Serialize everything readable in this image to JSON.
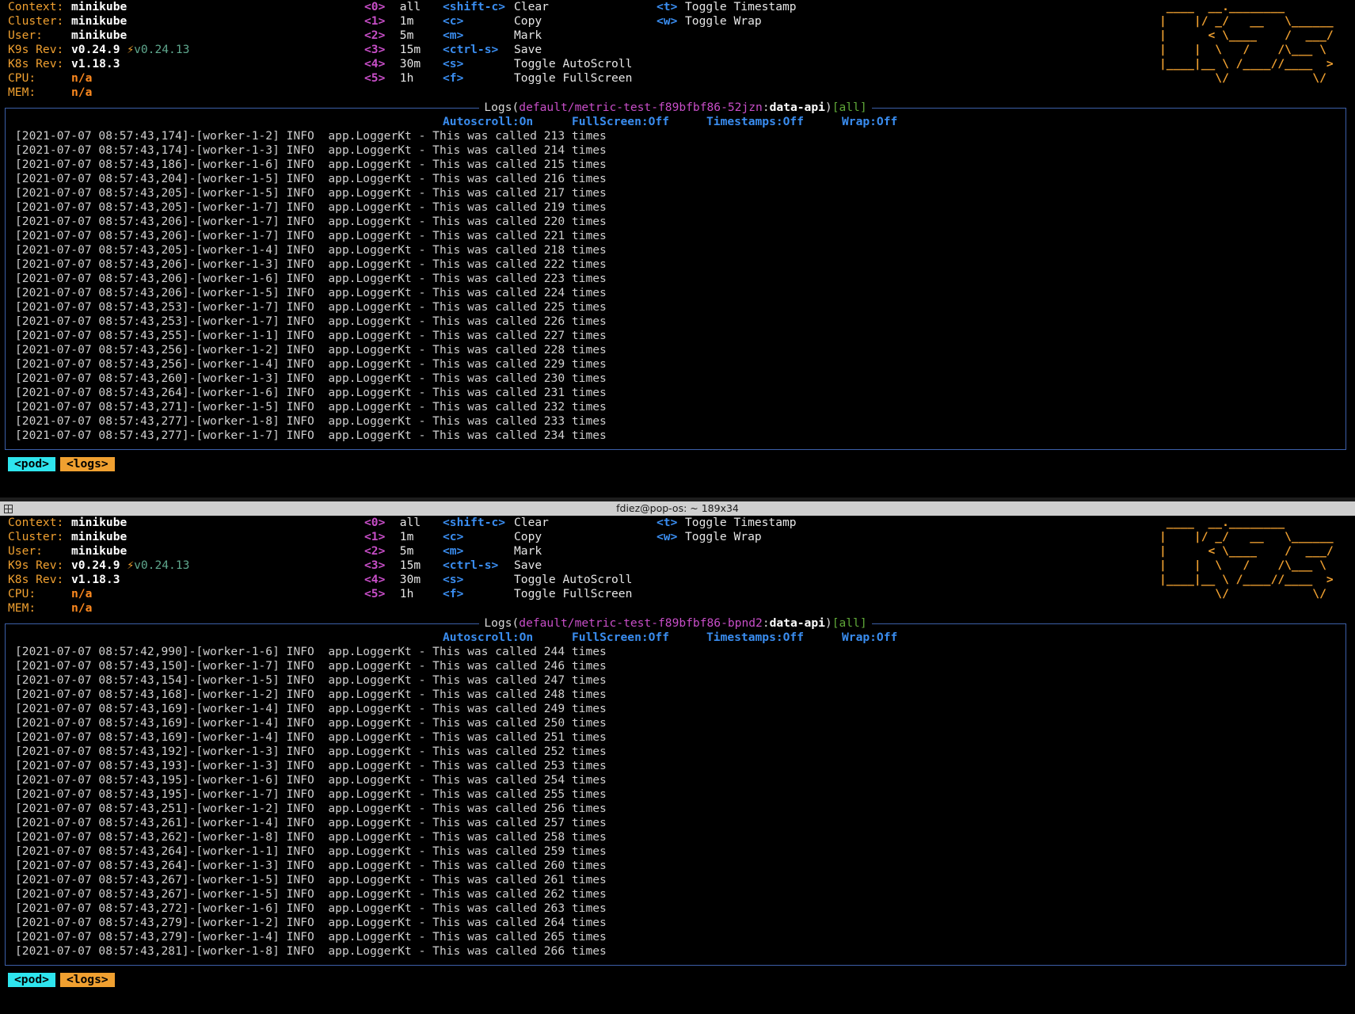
{
  "title_bar": {
    "text": "fdiez@pop-os: ~ 189x34"
  },
  "panes": [
    {
      "info": {
        "context_label": "Context:",
        "context": "minikube",
        "cluster_label": "Cluster:",
        "cluster": "minikube",
        "user_label": "User:",
        "user": "minikube",
        "k9s_label": "K9s Rev:",
        "k9s_rev": "v0.24.9",
        "k9s_new": "v0.24.13",
        "k8s_label": "K8s Rev:",
        "k8s_rev": "v1.18.3",
        "cpu_label": "CPU:",
        "cpu": "n/a",
        "mem_label": "MEM:",
        "mem": "n/a"
      },
      "ranges": [
        {
          "key": "<0>",
          "label": "all"
        },
        {
          "key": "<1>",
          "label": "1m"
        },
        {
          "key": "<2>",
          "label": "5m"
        },
        {
          "key": "<3>",
          "label": "15m"
        },
        {
          "key": "<4>",
          "label": "30m"
        },
        {
          "key": "<5>",
          "label": "1h"
        }
      ],
      "hotkeys": [
        {
          "key": "<shift-c>",
          "label": "Clear"
        },
        {
          "key": "<c>",
          "label": "Copy"
        },
        {
          "key": "<m>",
          "label": "Mark"
        },
        {
          "key": "<ctrl-s>",
          "label": "Save"
        },
        {
          "key": "<s>",
          "label": "Toggle AutoScroll"
        },
        {
          "key": "<f>",
          "label": "Toggle FullScreen"
        }
      ],
      "toggles": [
        {
          "key": "<t>",
          "label": "Toggle Timestamp"
        },
        {
          "key": "<w>",
          "label": "Toggle Wrap"
        }
      ],
      "logo": [
        " ____  __.________       ",
        "|    |/ _/   __   \\______",
        "|      < \\____    /  ___/",
        "|    |  \\   /    /\\___ \\ ",
        "|____|__ \\ /____//____  >",
        "        \\/            \\/ "
      ],
      "log_title": {
        "prefix": "Logs(",
        "path": "default/metric-test-f89bfbf86-52jzn",
        "sep": ":",
        "container": "data-api",
        "suffix": ")",
        "filter": "[all]"
      },
      "status": {
        "autoscroll": "Autoscroll:On",
        "fullscreen": "FullScreen:Off",
        "timestamps": "Timestamps:Off",
        "wrap": "Wrap:Off"
      },
      "logs": [
        "[2021-07-07 08:57:43,174]-[worker-1-2] INFO  app.LoggerKt - This was called 213 times",
        "[2021-07-07 08:57:43,174]-[worker-1-3] INFO  app.LoggerKt - This was called 214 times",
        "[2021-07-07 08:57:43,186]-[worker-1-6] INFO  app.LoggerKt - This was called 215 times",
        "[2021-07-07 08:57:43,204]-[worker-1-5] INFO  app.LoggerKt - This was called 216 times",
        "[2021-07-07 08:57:43,205]-[worker-1-5] INFO  app.LoggerKt - This was called 217 times",
        "[2021-07-07 08:57:43,205]-[worker-1-7] INFO  app.LoggerKt - This was called 219 times",
        "[2021-07-07 08:57:43,206]-[worker-1-7] INFO  app.LoggerKt - This was called 220 times",
        "[2021-07-07 08:57:43,206]-[worker-1-7] INFO  app.LoggerKt - This was called 221 times",
        "[2021-07-07 08:57:43,205]-[worker-1-4] INFO  app.LoggerKt - This was called 218 times",
        "[2021-07-07 08:57:43,206]-[worker-1-3] INFO  app.LoggerKt - This was called 222 times",
        "[2021-07-07 08:57:43,206]-[worker-1-6] INFO  app.LoggerKt - This was called 223 times",
        "[2021-07-07 08:57:43,206]-[worker-1-5] INFO  app.LoggerKt - This was called 224 times",
        "[2021-07-07 08:57:43,253]-[worker-1-7] INFO  app.LoggerKt - This was called 225 times",
        "[2021-07-07 08:57:43,253]-[worker-1-7] INFO  app.LoggerKt - This was called 226 times",
        "[2021-07-07 08:57:43,255]-[worker-1-1] INFO  app.LoggerKt - This was called 227 times",
        "[2021-07-07 08:57:43,256]-[worker-1-2] INFO  app.LoggerKt - This was called 228 times",
        "[2021-07-07 08:57:43,256]-[worker-1-4] INFO  app.LoggerKt - This was called 229 times",
        "[2021-07-07 08:57:43,260]-[worker-1-3] INFO  app.LoggerKt - This was called 230 times",
        "[2021-07-07 08:57:43,264]-[worker-1-6] INFO  app.LoggerKt - This was called 231 times",
        "[2021-07-07 08:57:43,271]-[worker-1-5] INFO  app.LoggerKt - This was called 232 times",
        "[2021-07-07 08:57:43,277]-[worker-1-8] INFO  app.LoggerKt - This was called 233 times",
        "[2021-07-07 08:57:43,277]-[worker-1-7] INFO  app.LoggerKt - This was called 234 times"
      ],
      "crumbs": {
        "pod": "<pod>",
        "logs": "<logs>"
      }
    },
    {
      "info": {
        "context_label": "Context:",
        "context": "minikube",
        "cluster_label": "Cluster:",
        "cluster": "minikube",
        "user_label": "User:",
        "user": "minikube",
        "k9s_label": "K9s Rev:",
        "k9s_rev": "v0.24.9",
        "k9s_new": "v0.24.13",
        "k8s_label": "K8s Rev:",
        "k8s_rev": "v1.18.3",
        "cpu_label": "CPU:",
        "cpu": "n/a",
        "mem_label": "MEM:",
        "mem": "n/a"
      },
      "ranges": [
        {
          "key": "<0>",
          "label": "all"
        },
        {
          "key": "<1>",
          "label": "1m"
        },
        {
          "key": "<2>",
          "label": "5m"
        },
        {
          "key": "<3>",
          "label": "15m"
        },
        {
          "key": "<4>",
          "label": "30m"
        },
        {
          "key": "<5>",
          "label": "1h"
        }
      ],
      "hotkeys": [
        {
          "key": "<shift-c>",
          "label": "Clear"
        },
        {
          "key": "<c>",
          "label": "Copy"
        },
        {
          "key": "<m>",
          "label": "Mark"
        },
        {
          "key": "<ctrl-s>",
          "label": "Save"
        },
        {
          "key": "<s>",
          "label": "Toggle AutoScroll"
        },
        {
          "key": "<f>",
          "label": "Toggle FullScreen"
        }
      ],
      "toggles": [
        {
          "key": "<t>",
          "label": "Toggle Timestamp"
        },
        {
          "key": "<w>",
          "label": "Toggle Wrap"
        }
      ],
      "logo": [
        " ____  __.________       ",
        "|    |/ _/   __   \\______",
        "|      < \\____    /  ___/",
        "|    |  \\   /    /\\___ \\ ",
        "|____|__ \\ /____//____  >",
        "        \\/            \\/ "
      ],
      "log_title": {
        "prefix": "Logs(",
        "path": "default/metric-test-f89bfbf86-bpnd2",
        "sep": ":",
        "container": "data-api",
        "suffix": ")",
        "filter": "[all]"
      },
      "status": {
        "autoscroll": "Autoscroll:On",
        "fullscreen": "FullScreen:Off",
        "timestamps": "Timestamps:Off",
        "wrap": "Wrap:Off"
      },
      "logs": [
        "[2021-07-07 08:57:42,990]-[worker-1-6] INFO  app.LoggerKt - This was called 244 times",
        "[2021-07-07 08:57:43,150]-[worker-1-7] INFO  app.LoggerKt - This was called 246 times",
        "[2021-07-07 08:57:43,154]-[worker-1-5] INFO  app.LoggerKt - This was called 247 times",
        "[2021-07-07 08:57:43,168]-[worker-1-2] INFO  app.LoggerKt - This was called 248 times",
        "[2021-07-07 08:57:43,169]-[worker-1-4] INFO  app.LoggerKt - This was called 249 times",
        "[2021-07-07 08:57:43,169]-[worker-1-4] INFO  app.LoggerKt - This was called 250 times",
        "[2021-07-07 08:57:43,169]-[worker-1-4] INFO  app.LoggerKt - This was called 251 times",
        "[2021-07-07 08:57:43,192]-[worker-1-3] INFO  app.LoggerKt - This was called 252 times",
        "[2021-07-07 08:57:43,193]-[worker-1-3] INFO  app.LoggerKt - This was called 253 times",
        "[2021-07-07 08:57:43,195]-[worker-1-6] INFO  app.LoggerKt - This was called 254 times",
        "[2021-07-07 08:57:43,195]-[worker-1-7] INFO  app.LoggerKt - This was called 255 times",
        "[2021-07-07 08:57:43,251]-[worker-1-2] INFO  app.LoggerKt - This was called 256 times",
        "[2021-07-07 08:57:43,261]-[worker-1-4] INFO  app.LoggerKt - This was called 257 times",
        "[2021-07-07 08:57:43,262]-[worker-1-8] INFO  app.LoggerKt - This was called 258 times",
        "[2021-07-07 08:57:43,264]-[worker-1-1] INFO  app.LoggerKt - This was called 259 times",
        "[2021-07-07 08:57:43,264]-[worker-1-3] INFO  app.LoggerKt - This was called 260 times",
        "[2021-07-07 08:57:43,267]-[worker-1-5] INFO  app.LoggerKt - This was called 261 times",
        "[2021-07-07 08:57:43,267]-[worker-1-5] INFO  app.LoggerKt - This was called 262 times",
        "[2021-07-07 08:57:43,272]-[worker-1-6] INFO  app.LoggerKt - This was called 263 times",
        "[2021-07-07 08:57:43,279]-[worker-1-2] INFO  app.LoggerKt - This was called 264 times",
        "[2021-07-07 08:57:43,279]-[worker-1-4] INFO  app.LoggerKt - This was called 265 times",
        "[2021-07-07 08:57:43,281]-[worker-1-8] INFO  app.LoggerKt - This was called 266 times"
      ],
      "crumbs": {
        "pod": "<pod>",
        "logs": "<logs>"
      }
    }
  ]
}
